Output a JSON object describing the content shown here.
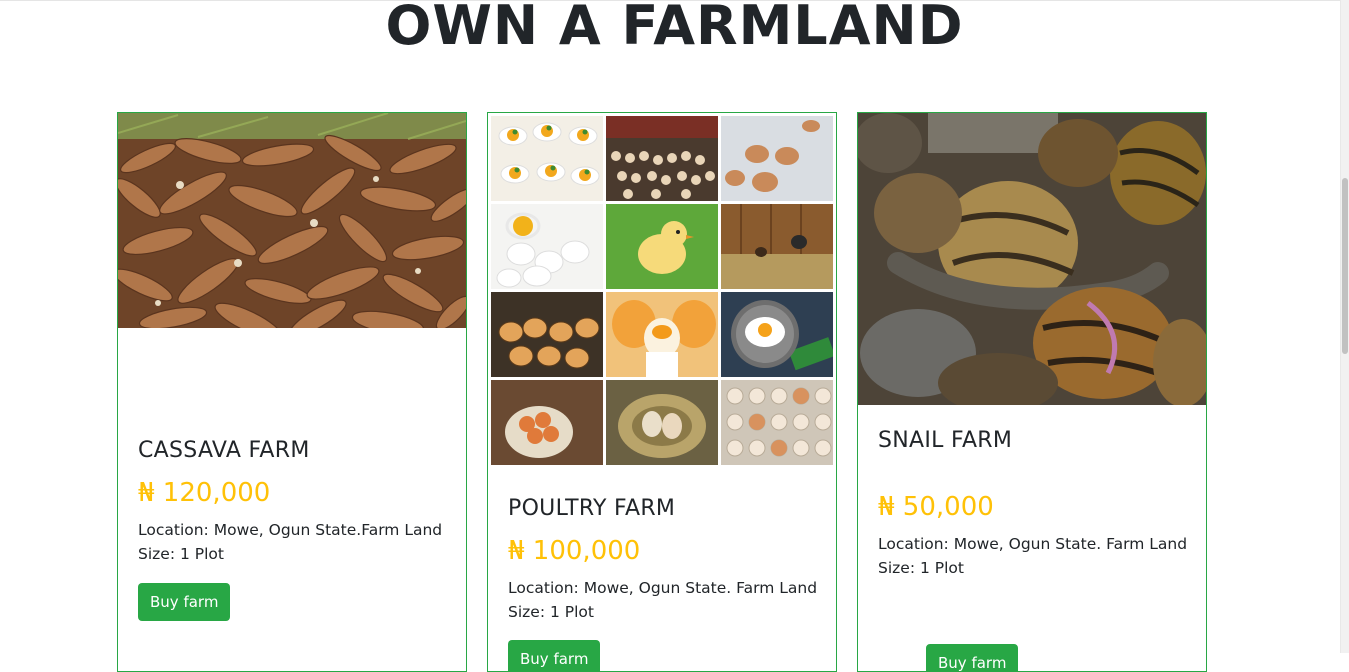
{
  "page": {
    "title": "OWN A FARMLAND"
  },
  "farms": [
    {
      "name": "CASSAVA FARM",
      "price": "₦ 120,000",
      "location": "Location: Mowe, Ogun State.Farm Land",
      "size": "Size: 1 Plot",
      "button_label": "Buy farm",
      "image_icon": "cassava-image"
    },
    {
      "name": "POULTRY FARM",
      "price": "₦ 100,000",
      "location": "Location: Mowe, Ogun State. Farm Land",
      "size": "Size: 1 Plot",
      "button_label": "Buy farm",
      "image_icon": "poultry-collage-image"
    },
    {
      "name": "SNAIL FARM",
      "price": "₦ 50,000",
      "location": "Location: Mowe, Ogun State. Farm Land",
      "size": "Size: 1 Plot",
      "button_label": "Buy farm",
      "image_icon": "snail-image"
    }
  ],
  "colors": {
    "accent_green": "#28a745",
    "price_yellow": "#ffc107",
    "text_dark": "#212529"
  }
}
